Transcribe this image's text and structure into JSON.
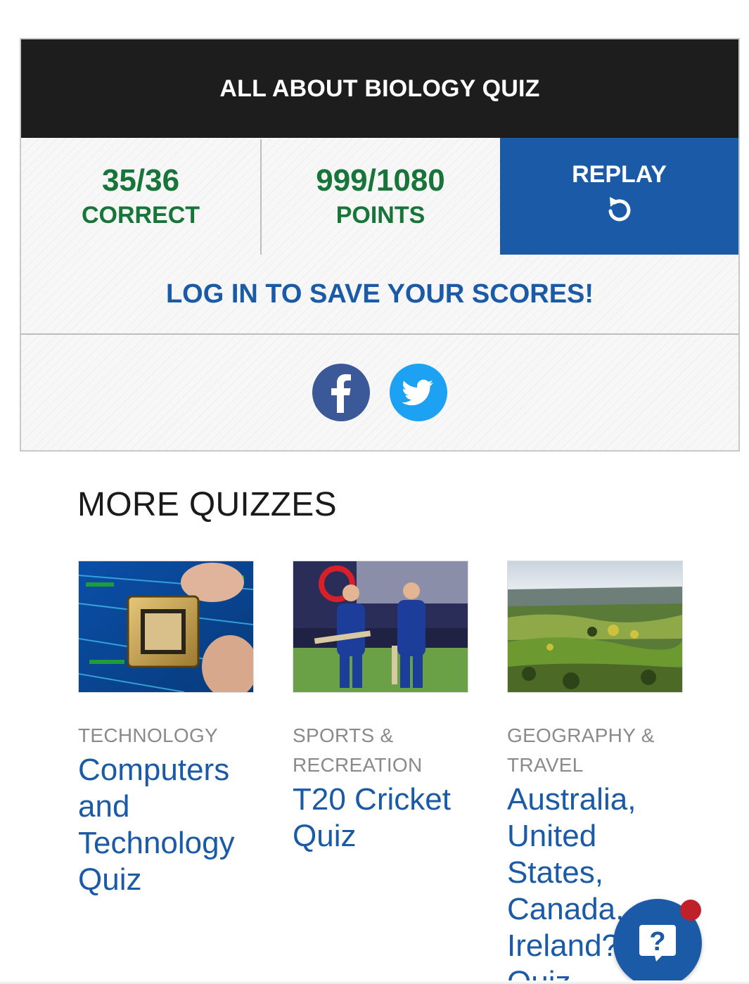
{
  "result": {
    "title": "ALL ABOUT BIOLOGY QUIZ",
    "correct_value": "35/36",
    "correct_label": "CORRECT",
    "points_value": "999/1080",
    "points_label": "POINTS",
    "replay_label": "REPLAY",
    "login_prompt": "LOG IN TO SAVE YOUR SCORES!",
    "share": {
      "facebook_icon": "facebook-icon",
      "twitter_icon": "twitter-icon"
    }
  },
  "more_quizzes": {
    "heading": "MORE QUIZZES",
    "items": [
      {
        "category": "TECHNOLOGY",
        "title": "Computers and Technology Quiz",
        "image": "computer-chip-photo"
      },
      {
        "category": "SPORTS & RECREATION",
        "title": "T20 Cricket Quiz",
        "image": "cricket-players-photo"
      },
      {
        "category": "GEOGRAPHY & TRAVEL",
        "title": "Australia, United States, Canada, or Ireland? Quiz",
        "image": "countryside-landscape-photo"
      }
    ]
  },
  "help": {
    "icon": "help-question-icon",
    "symbol": "?"
  },
  "colors": {
    "title_bar": "#1d1d1d",
    "score_green": "#17753a",
    "brand_blue": "#1a5aa6",
    "facebook": "#3b5998",
    "twitter": "#1da1f2",
    "notification_dot": "#c0202a"
  }
}
